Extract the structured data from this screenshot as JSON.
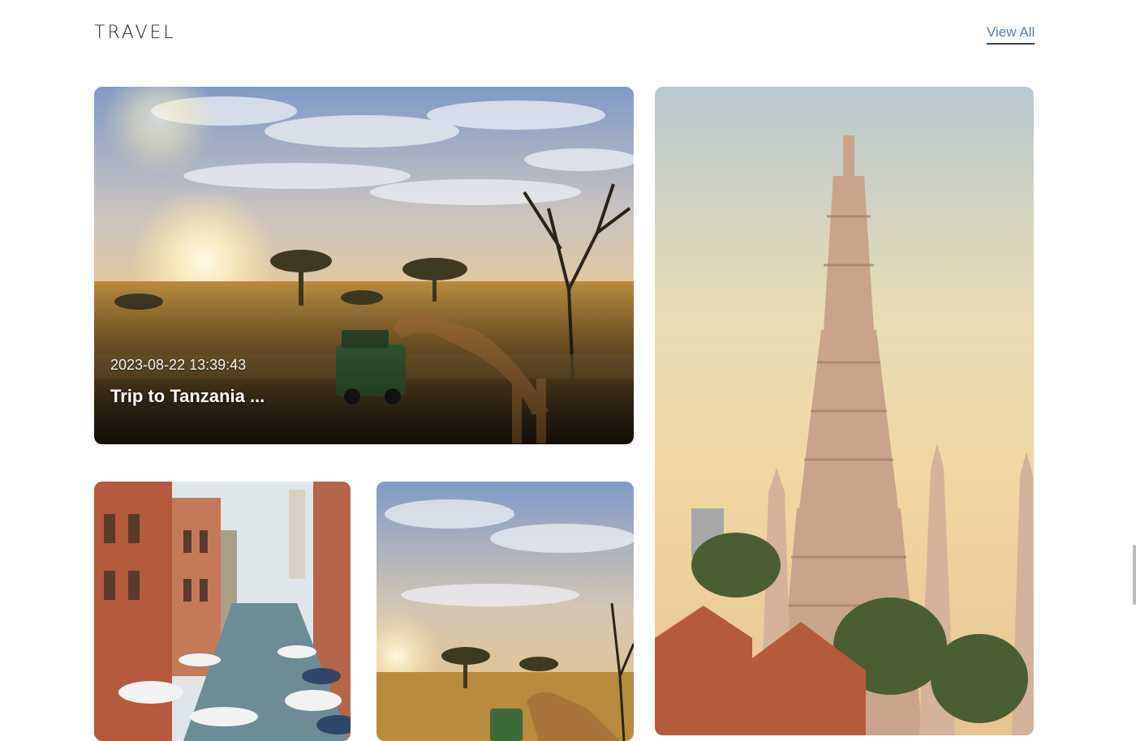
{
  "section": {
    "title": "TRAVEL",
    "view_all_label": "View All"
  },
  "cards": [
    {
      "id": "tanzania",
      "date": "2023-08-22 13:39:43",
      "title": "Trip to Tanzania ...",
      "scene": "savanna with giraffe and safari jeep at sunrise"
    },
    {
      "id": "bangkok",
      "scene": "temple spire at sunset"
    },
    {
      "id": "venice",
      "scene": "canal with boats and buildings"
    },
    {
      "id": "safari-2",
      "scene": "savanna with giraffe and safari jeep at sunrise"
    }
  ],
  "colors": {
    "title_text": "#222222",
    "link_text": "#5a7bb0",
    "link_underline": "#2c3e6e"
  }
}
